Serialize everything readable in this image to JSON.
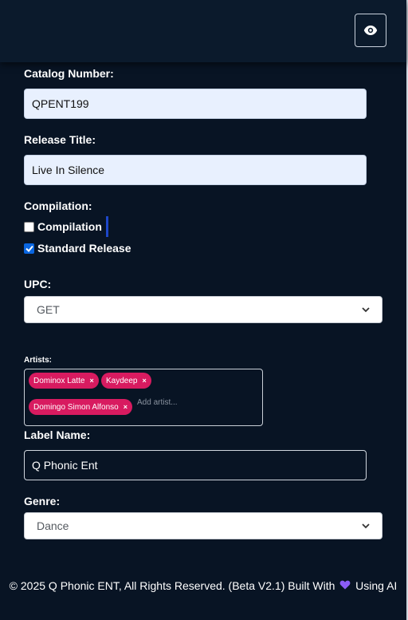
{
  "header": {
    "visibility_icon": "eye-icon"
  },
  "form": {
    "catalog_number": {
      "label": "Catalog Number:",
      "value": "QPENT199"
    },
    "release_title": {
      "label": "Release Title:",
      "value": "Live In Silence"
    },
    "compilation": {
      "label": "Compilation:",
      "options": [
        {
          "label": "Compilation",
          "checked": false
        },
        {
          "label": "Standard Release",
          "checked": true
        }
      ]
    },
    "upc": {
      "label": "UPC:",
      "selected": "GET"
    },
    "artists": {
      "label": "Artists:",
      "tags": [
        "Dominox Latte",
        "Kaydeep",
        "Domingo Simon Alfonso"
      ],
      "remove_glyph": "×",
      "placeholder": "Add artist..."
    },
    "label_name": {
      "label": "Label Name:",
      "value": "Q Phonic Ent"
    },
    "genre": {
      "label": "Genre:",
      "selected": "Dance"
    }
  },
  "footer": {
    "text_before": "© 2025 Q Phonic ENT, All Rights Reserved. (Beta V2.1) Built With",
    "heart_icon": "heart-icon",
    "text_after": "Using AI"
  },
  "colors": {
    "background": "#081424",
    "header": "#0b1a2c",
    "tag": "#d81b60",
    "heart": "#8b5cf6",
    "input_fill": "#e8f0fe",
    "checkbox_checked": "#0a66e0"
  }
}
